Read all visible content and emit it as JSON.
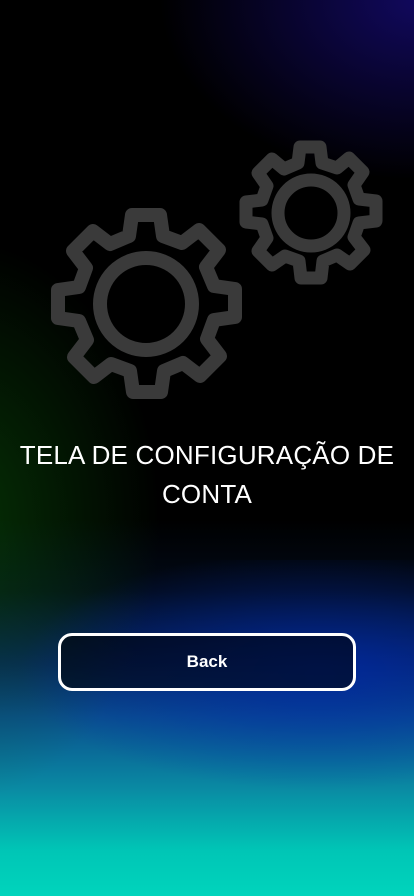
{
  "screen": {
    "title": "TELA DE CONFIGURAÇÃO DE CONTA",
    "illustration_icon": "gears-icon",
    "back_button_label": "Back"
  },
  "colors": {
    "gear_stroke": "#3a3a3a",
    "text": "#ffffff",
    "button_border": "#ffffff",
    "gradient_bottom": "#00d4bc",
    "gradient_mid_blue": "#06245e"
  }
}
